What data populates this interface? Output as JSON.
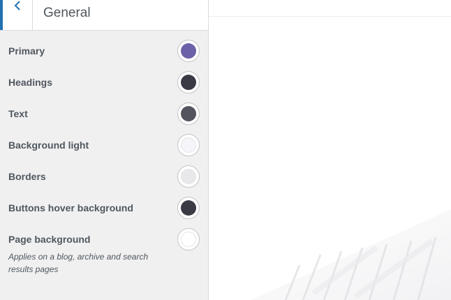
{
  "panel": {
    "title": "General",
    "back_icon": "chevron-left-icon"
  },
  "colors": [
    {
      "label": "Primary",
      "color": "#6a61a8"
    },
    {
      "label": "Headings",
      "color": "#3a3a45"
    },
    {
      "label": "Text",
      "color": "#54545f"
    },
    {
      "label": "Background light",
      "color": "#f5f5fa"
    },
    {
      "label": "Borders",
      "color": "#e8e8ea"
    },
    {
      "label": "Buttons hover background",
      "color": "#3a3a45"
    },
    {
      "label": "Page background",
      "description": "Applies on a blog, archive and search results pages",
      "color": "#ffffff"
    }
  ],
  "theme": {
    "accent": "#2271b1",
    "panel_bg": "#f0f0f1",
    "text": "#50575e"
  }
}
